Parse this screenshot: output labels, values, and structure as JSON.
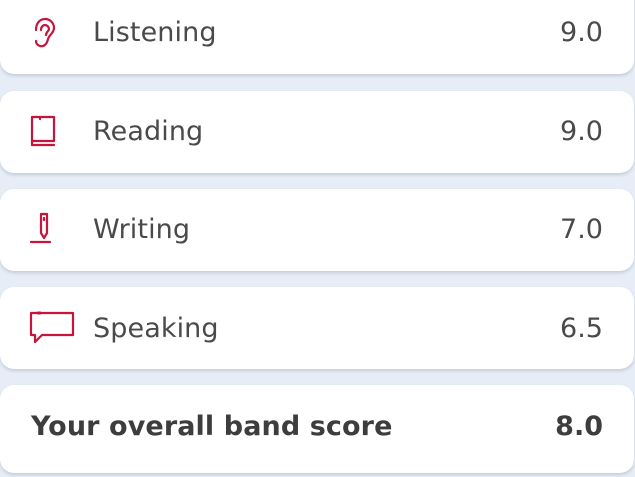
{
  "accent_color": "#c8143c",
  "skills": [
    {
      "label": "Listening",
      "score": "9.0",
      "icon": "ear-icon"
    },
    {
      "label": "Reading",
      "score": "9.0",
      "icon": "book-icon"
    },
    {
      "label": "Writing",
      "score": "7.0",
      "icon": "pencil-icon"
    },
    {
      "label": "Speaking",
      "score": "6.5",
      "icon": "speech-bubble-icon"
    }
  ],
  "overall": {
    "label": "Your overall band score",
    "score": "8.0"
  }
}
